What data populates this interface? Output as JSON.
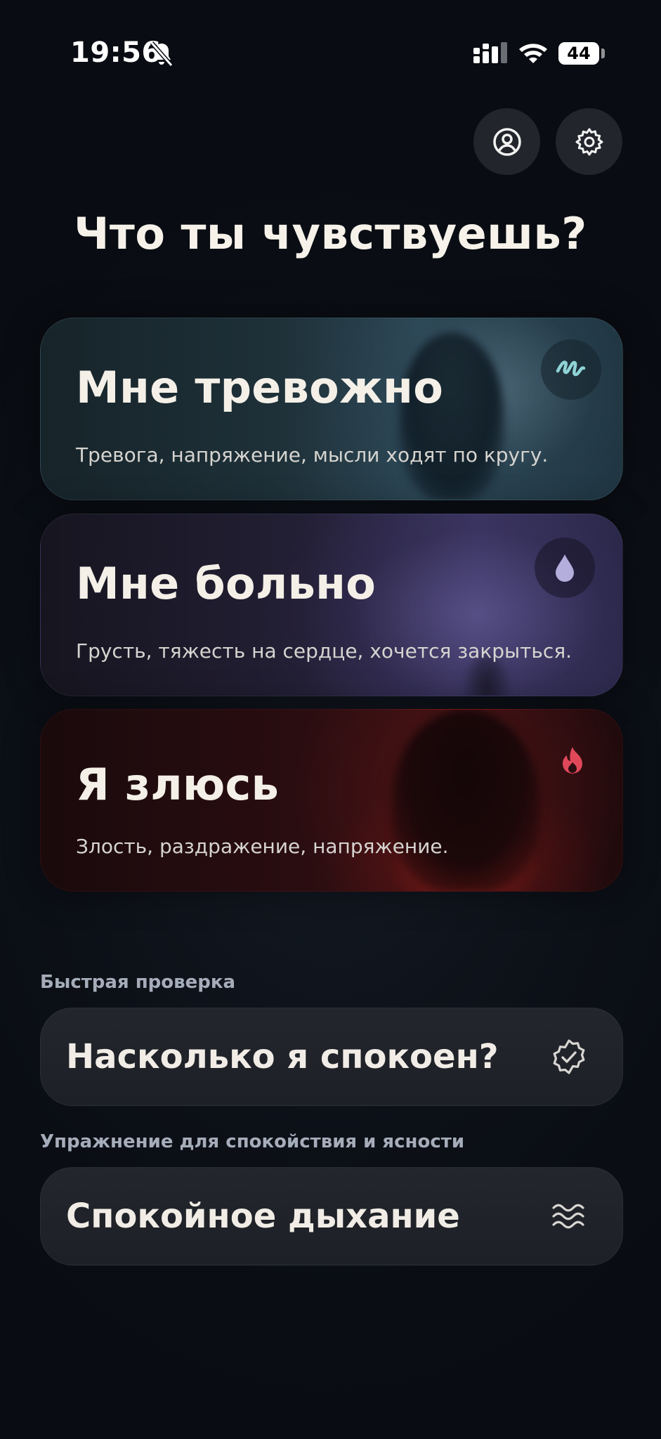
{
  "status_bar": {
    "time": "19:56",
    "battery": "44",
    "icons": [
      "bell-off-icon",
      "signal-icon",
      "wifi-icon",
      "battery-icon"
    ]
  },
  "header": {
    "buttons": [
      {
        "name": "profile-button",
        "icon": "user-circle-icon"
      },
      {
        "name": "settings-button",
        "icon": "gear-icon"
      }
    ]
  },
  "main": {
    "title": "Что ты чувствуешь?",
    "emotions": [
      {
        "title": "Мне тревожно",
        "subtitle": "Тревога, напряжение, мысли ходят по кругу.",
        "icon": "scribble-icon",
        "accent": "#8fd3d6"
      },
      {
        "title": "Мне больно",
        "subtitle": "Грусть, тяжесть на сердце, хочется закрыться.",
        "icon": "drop-icon",
        "accent": "#b4aedc"
      },
      {
        "title": "Я злюсь",
        "subtitle": "Злость, раздражение, напряжение.",
        "icon": "flame-icon",
        "accent": "#e0485a"
      }
    ]
  },
  "quick_check": {
    "label": "Быстрая проверка",
    "button": "Насколько я спокоен?",
    "icon": "badge-check-icon"
  },
  "exercise": {
    "label": "Упражнение для спокойствия и ясности",
    "button": "Спокойное дыхание",
    "icon": "waves-icon"
  }
}
